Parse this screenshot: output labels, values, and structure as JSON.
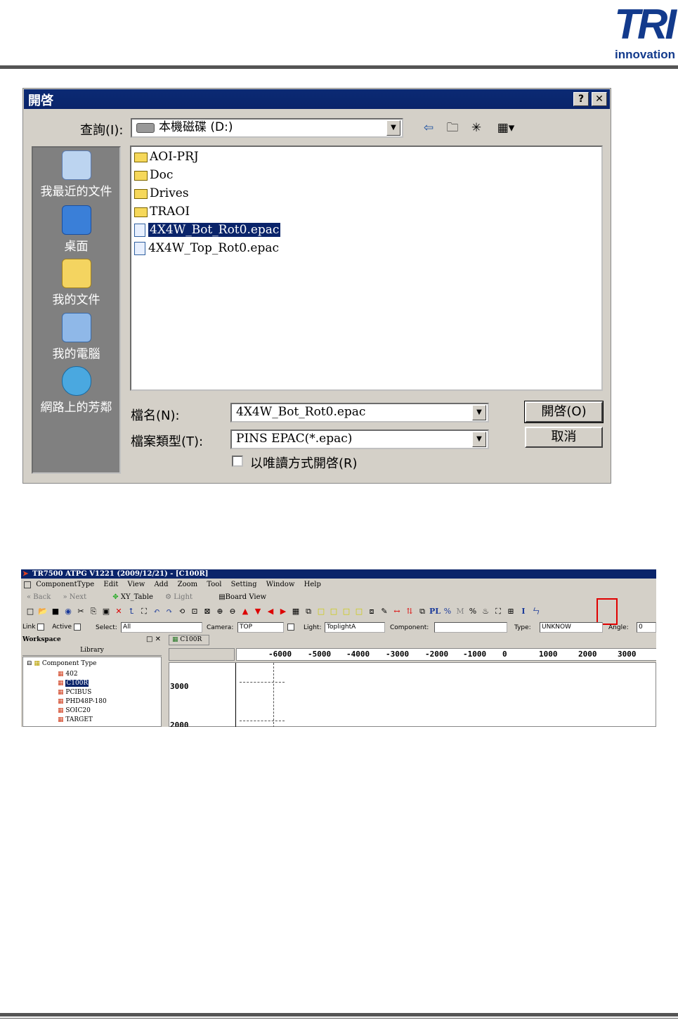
{
  "logo": {
    "brand": "TRI",
    "sub": "innovation"
  },
  "dialog": {
    "title": "開啓",
    "help_btn": "?",
    "close_btn": "✕",
    "lookin_label": "查詢(I):",
    "lookin_value": "本機磁碟 (D:)",
    "places": [
      {
        "label": "我最近的文件",
        "icon": "recent-documents-icon"
      },
      {
        "label": "桌面",
        "icon": "desktop-icon"
      },
      {
        "label": "我的文件",
        "icon": "my-documents-icon"
      },
      {
        "label": "我的電腦",
        "icon": "my-computer-icon"
      },
      {
        "label": "網路上的芳鄰",
        "icon": "network-places-icon"
      }
    ],
    "files": [
      {
        "name": "AOI-PRJ",
        "kind": "folder"
      },
      {
        "name": "Doc",
        "kind": "folder"
      },
      {
        "name": "Drives",
        "kind": "folder"
      },
      {
        "name": "TRAOI",
        "kind": "folder"
      },
      {
        "name": "4X4W_Bot_Rot0.epac",
        "kind": "file",
        "selected": true
      },
      {
        "name": "4X4W_Top_Rot0.epac",
        "kind": "file"
      }
    ],
    "filename_label": "檔名(N):",
    "filename_value": "4X4W_Bot_Rot0.epac",
    "filetype_label": "檔案類型(T):",
    "filetype_value": "PINS EPAC(*.epac)",
    "readonly_label": "以唯讀方式開啓(R)",
    "open_btn": "開啓(O)",
    "cancel_btn": "取消"
  },
  "app": {
    "title": "TR7500 ATPG V1221 (2009/12/21) - [C100R]",
    "menu": [
      "ComponentType",
      "Edit",
      "View",
      "Add",
      "Zoom",
      "Tool",
      "Setting",
      "Window",
      "Help"
    ],
    "nav": {
      "back": "Back",
      "next": "Next",
      "xy_table": "XY_Table",
      "light": "Light",
      "board_view": "Board View"
    },
    "filters": {
      "link": "Link",
      "active": "Active",
      "select_label": "Select:",
      "select_value": "All",
      "camera_label": "Camera:",
      "camera_value": "TOP",
      "light_label": "Light:",
      "light_value": "ToplightA",
      "component_label": "Component:",
      "component_value": "",
      "type_label": "Type:",
      "type_value": "UNKNOW",
      "angle_label": "Angle:",
      "angle_value": "0"
    },
    "workspace": {
      "label": "Workspace",
      "library": "Library",
      "root": "Component Type",
      "items": [
        "402",
        "C100R",
        "PCIBUS",
        "PHD48P-180",
        "SOIC20",
        "TARGET"
      ]
    },
    "doc_tab": "C100R",
    "ruler_ticks": [
      "-6000",
      "-5000",
      "-4000",
      "-3000",
      "-2000",
      "-1000",
      "0",
      "1000",
      "2000",
      "3000"
    ],
    "y_ticks": [
      "3000",
      "2000"
    ]
  },
  "colors": {
    "title_bar": "#0a246a",
    "logo_blue": "#123a8c",
    "highlight_box": "#e00000"
  }
}
